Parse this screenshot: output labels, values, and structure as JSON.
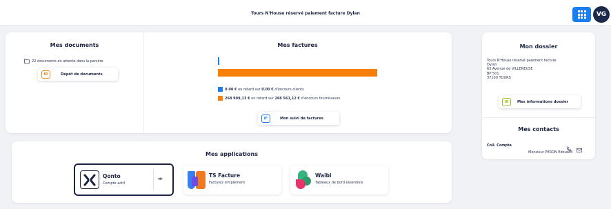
{
  "header": {
    "title": "Tours N'House réservé paiement facture Dylan",
    "user_initials": "VG",
    "apps_icon": "grid-icon",
    "accent_color": "#1a7df0"
  },
  "documents": {
    "title": "Mes documents",
    "pending_text": "22 documents en attente dans la panière",
    "button_label": "Dépôt de documents",
    "button_badge": "ID",
    "badge_color": "#f28a22"
  },
  "invoices": {
    "title": "Mes factures",
    "clients": {
      "amount": "0.00 €",
      "mid": "en retard sur",
      "total": "0.00 €",
      "suffix": "d'encours clients",
      "color": "#1a7df0",
      "fill_fraction": 0.0
    },
    "suppliers": {
      "amount": "268 999,13 €",
      "mid": "en retard sur",
      "total": "268 561,12 €",
      "suffix": "d'encours fournisseurs",
      "color": "#f97f0b",
      "fill_fraction": 1.0
    },
    "button_label": "Mon suivi de factures",
    "button_badge": "iF",
    "badge_color": "#1a7df0"
  },
  "applications": {
    "title": "Mes applications",
    "items": [
      {
        "name": "Qonto",
        "subtitle": "Compte actif",
        "icon": "qonto-logo-icon",
        "action_icon": "unlink-icon"
      },
      {
        "name": "TS Facture",
        "subtitle": "Facturez simplement",
        "icon": "ts-facture-logo-icon"
      },
      {
        "name": "Waibi",
        "subtitle": "Tableaux de bord essentiels",
        "icon": "waibi-logo-icon"
      }
    ]
  },
  "dossier": {
    "title": "Mon dossier",
    "address_lines": [
      "Tours N'House réservé paiement facture",
      "Dylan",
      "63 Avenue de VILLENEUSE",
      "BP 501",
      "37100 TOURS"
    ],
    "button_label": "Mes informations dossier",
    "button_badge": "ID",
    "badge_color": "#9bc21a"
  },
  "contacts": {
    "title": "Mes contacts",
    "role": "Coll. Compta",
    "name": "Monsieur PERON Edouard",
    "phone_icon": "phone-icon",
    "mail_icon": "mail-icon"
  }
}
